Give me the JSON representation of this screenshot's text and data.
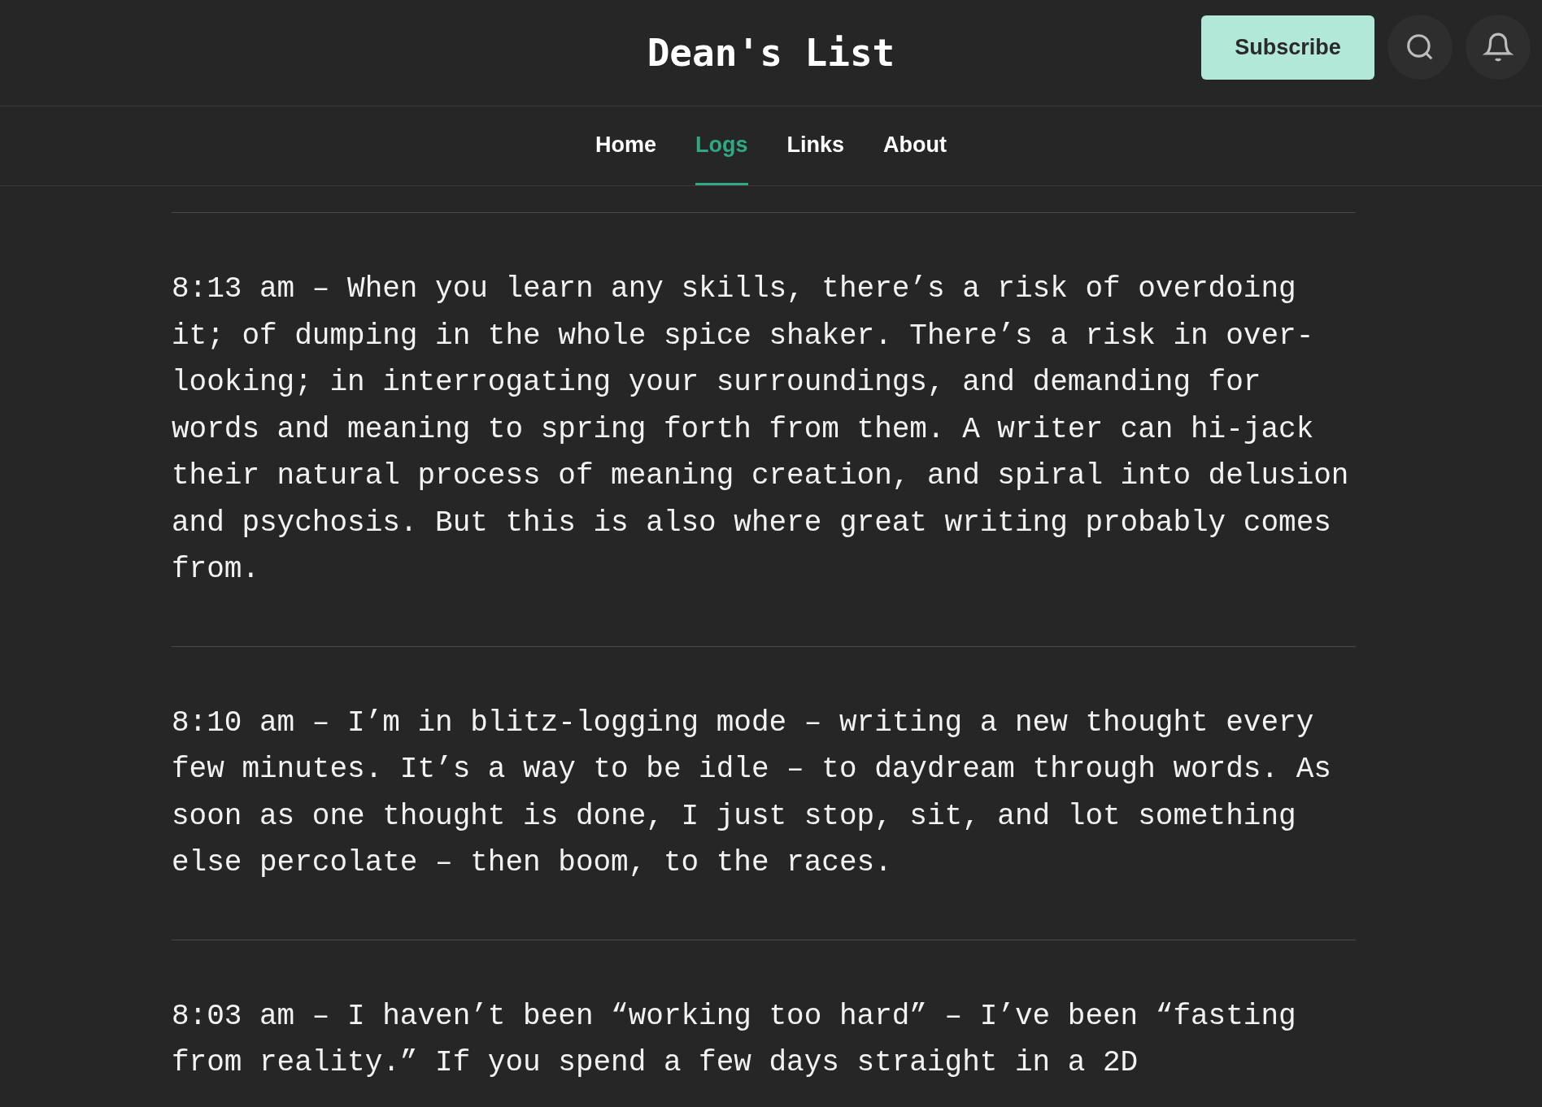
{
  "header": {
    "title": "Dean's List",
    "subscribe": "Subscribe"
  },
  "nav": [
    {
      "label": "Home",
      "selected": false
    },
    {
      "label": "Logs",
      "selected": true
    },
    {
      "label": "Links",
      "selected": false
    },
    {
      "label": "About",
      "selected": false
    }
  ],
  "entries": [
    "8:13 am – When you learn any skills, there’s a risk of overdoing it; of dumping in the whole spice shaker. There’s a risk in over-looking; in interrogating your surroundings, and demanding for words and meaning to spring forth from them. A writer can hi-jack their natural process of meaning creation, and spiral into delusion and psychosis. But this is also where great writing probably comes from.",
    "8:10 am – I’m in blitz-logging mode – writing a new thought every few minutes. It’s a way to be idle – to daydream through words. As soon as one thought is done, I just stop, sit, and lot something else percolate – then boom, to the races.",
    "8:03 am – I haven’t been “working too hard” – I’ve been “fasting from reality.” If you spend a few days straight in a 2D"
  ]
}
